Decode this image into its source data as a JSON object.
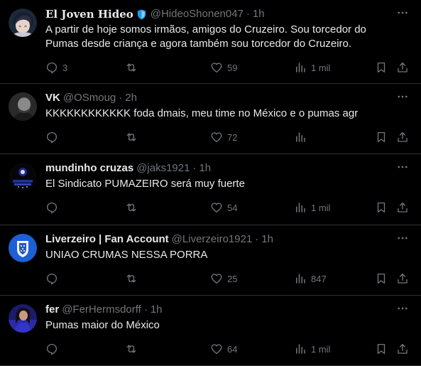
{
  "tweets": [
    {
      "name": "El Joven Hideo",
      "verified": true,
      "handle": "@HideoShonen047",
      "time": "1h",
      "text": "A partir de hoje somos irmãos, amigos do Cruzeiro. Sou torcedor do Pumas desde criança e agora também sou torcedor do Cruzeiro.",
      "replies": "3",
      "retweets": "",
      "likes": "59",
      "views": "1 mil",
      "avatar": "anime-avatar"
    },
    {
      "name": "VK",
      "verified": false,
      "handle": "@OSmoug",
      "time": "2h",
      "text": "KKKKKKKKKKKK foda dmais, meu time no México e o pumas agr",
      "replies": "",
      "retweets": "",
      "likes": "72",
      "views": "",
      "avatar": "dark-portrait-avatar"
    },
    {
      "name": "mundinho cruzas",
      "verified": false,
      "handle": "@jaks1921",
      "time": "1h",
      "text": "El Sindicato PUMAZEIRO será muy fuerte",
      "replies": "",
      "retweets": "",
      "likes": "54",
      "views": "1 mil",
      "avatar": "crest-dark-avatar"
    },
    {
      "name": "Liverzeiro | Fan Account",
      "verified": false,
      "handle": "@Liverzeiro1921",
      "time": "1h",
      "text": "UNIAO CRUMAS NESSA PORRA",
      "replies": "",
      "retweets": "",
      "likes": "25",
      "views": "847",
      "avatar": "blue-crest-avatar"
    },
    {
      "name": "fer",
      "verified": false,
      "handle": "@FerHermsdorff",
      "time": "1h",
      "text": "Pumas maior do México",
      "replies": "",
      "retweets": "",
      "likes": "64",
      "views": "1 mil",
      "avatar": "purple-portrait-avatar"
    }
  ],
  "separator": "·",
  "colors": {
    "background": "#000000",
    "text": "#e7e9ea",
    "muted": "#71767b",
    "border": "#2f3336",
    "verified_blue": "#1d9bf0"
  }
}
